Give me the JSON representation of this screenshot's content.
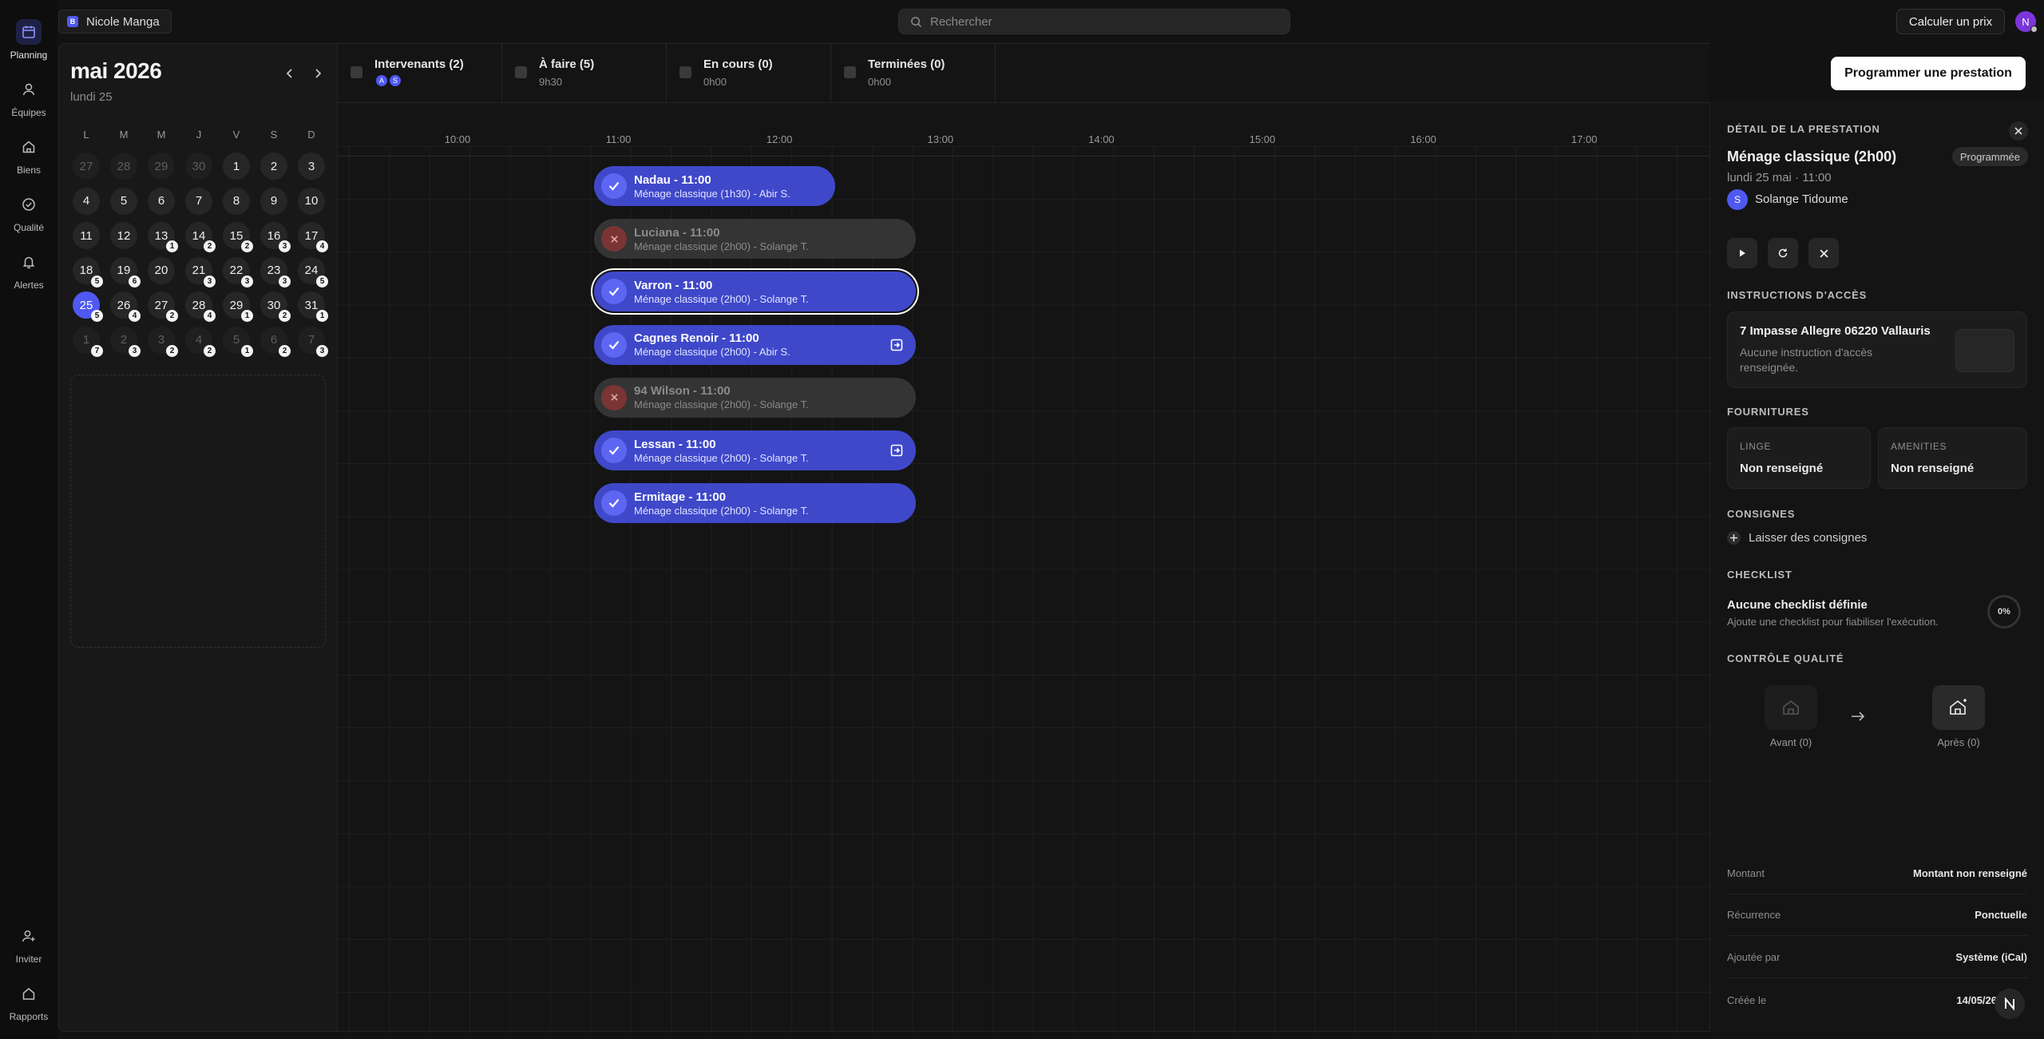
{
  "workspace": {
    "badge": "B",
    "name": "Nicole Manga"
  },
  "search": {
    "placeholder": "Rechercher"
  },
  "header": {
    "calc_button": "Calculer un prix",
    "avatar_initial": "N"
  },
  "nav": {
    "top": [
      {
        "label": "Planning",
        "icon": "calendar-icon",
        "active": true
      },
      {
        "label": "Équipes",
        "icon": "user-icon"
      },
      {
        "label": "Biens",
        "icon": "house-icon"
      },
      {
        "label": "Qualité",
        "icon": "check-circle-icon"
      },
      {
        "label": "Alertes",
        "icon": "bell-icon"
      }
    ],
    "bottom": [
      {
        "label": "Inviter",
        "icon": "user-plus-icon"
      },
      {
        "label": "Rapports",
        "icon": "home-icon"
      }
    ]
  },
  "calendar": {
    "month": "mai 2026",
    "selected_label": "lundi 25",
    "weekdays": [
      "L",
      "M",
      "M",
      "J",
      "V",
      "S",
      "D"
    ],
    "weeks": [
      [
        {
          "d": "27",
          "m": true
        },
        {
          "d": "28",
          "m": true
        },
        {
          "d": "29",
          "m": true
        },
        {
          "d": "30",
          "m": true
        },
        {
          "d": "1"
        },
        {
          "d": "2"
        },
        {
          "d": "3"
        }
      ],
      [
        {
          "d": "4"
        },
        {
          "d": "5"
        },
        {
          "d": "6"
        },
        {
          "d": "7"
        },
        {
          "d": "8"
        },
        {
          "d": "9"
        },
        {
          "d": "10"
        }
      ],
      [
        {
          "d": "11"
        },
        {
          "d": "12"
        },
        {
          "d": "13",
          "c": "1"
        },
        {
          "d": "14",
          "c": "2"
        },
        {
          "d": "15",
          "c": "2"
        },
        {
          "d": "16",
          "c": "3"
        },
        {
          "d": "17",
          "c": "4"
        }
      ],
      [
        {
          "d": "18",
          "c": "5"
        },
        {
          "d": "19",
          "c": "6"
        },
        {
          "d": "20"
        },
        {
          "d": "21",
          "c": "3"
        },
        {
          "d": "22",
          "c": "3"
        },
        {
          "d": "23",
          "c": "3"
        },
        {
          "d": "24",
          "c": "5"
        }
      ],
      [
        {
          "d": "25",
          "c": "5",
          "s": true
        },
        {
          "d": "26",
          "c": "4"
        },
        {
          "d": "27",
          "c": "2"
        },
        {
          "d": "28",
          "c": "4"
        },
        {
          "d": "29",
          "c": "1"
        },
        {
          "d": "30",
          "c": "2"
        },
        {
          "d": "31",
          "c": "1"
        }
      ],
      [
        {
          "d": "1",
          "m": true,
          "c": "7"
        },
        {
          "d": "2",
          "m": true,
          "c": "3"
        },
        {
          "d": "3",
          "m": true,
          "c": "2"
        },
        {
          "d": "4",
          "m": true,
          "c": "2"
        },
        {
          "d": "5",
          "m": true,
          "c": "1"
        },
        {
          "d": "6",
          "m": true,
          "c": "2"
        },
        {
          "d": "7",
          "m": true,
          "c": "3"
        }
      ]
    ]
  },
  "stats": [
    {
      "label": "Intervenants (2)",
      "sub": "",
      "avatars": [
        "A",
        "S"
      ]
    },
    {
      "label": "À faire (5)",
      "sub": "9h30"
    },
    {
      "label": "En cours (0)",
      "sub": "0h00"
    },
    {
      "label": "Terminées (0)",
      "sub": "0h00"
    }
  ],
  "schedule_button": "Programmer une prestation",
  "hours": [
    "10:00",
    "11:00",
    "12:00",
    "13:00",
    "14:00",
    "15:00",
    "16:00",
    "17:00"
  ],
  "events": [
    {
      "title": "Nadau - 11:00",
      "sub": "Ménage classique (1h30) - Abir S.",
      "status": "done"
    },
    {
      "title": "Luciana - 11:00",
      "sub": "Ménage classique (2h00) - Solange T.",
      "status": "cancelled"
    },
    {
      "title": "Varron - 11:00",
      "sub": "Ménage classique (2h00) - Solange T.",
      "status": "done",
      "selected": true
    },
    {
      "title": "Cagnes Renoir - 11:00",
      "sub": "Ménage classique (2h00) - Abir S.",
      "status": "done",
      "exit": true
    },
    {
      "title": "94 Wilson - 11:00",
      "sub": "Ménage classique (2h00) - Solange T.",
      "status": "cancelled"
    },
    {
      "title": "Lessan - 11:00",
      "sub": "Ménage classique (2h00) - Solange T.",
      "status": "done",
      "exit": true
    },
    {
      "title": "Ermitage - 11:00",
      "sub": "Ménage classique (2h00) - Solange T.",
      "status": "done"
    }
  ],
  "detail": {
    "header": "DÉTAIL DE LA PRESTATION",
    "title": "Ménage classique (2h00)",
    "status_badge": "Programmée",
    "datetime": "lundi 25 mai · 11:00",
    "assignee_initial": "S",
    "assignee": "Solange Tidoume",
    "access_header": "INSTRUCTIONS D'ACCÈS",
    "address": "7 Impasse Allegre 06220 Vallauris",
    "access_note": "Aucune instruction d'accès renseignée.",
    "supplies_header": "FOURNITURES",
    "linge_label": "LINGE",
    "linge_value": "Non renseigné",
    "amenities_label": "AMENITIES",
    "amenities_value": "Non renseigné",
    "instructions_header": "CONSIGNES",
    "leave_instructions": "Laisser des consignes",
    "checklist_header": "CHECKLIST",
    "checklist_title": "Aucune checklist définie",
    "checklist_sub": "Ajoute une checklist pour fiabiliser l'exécution.",
    "checklist_progress": "0%",
    "qc_header": "CONTRÔLE QUALITÉ",
    "before": "Avant (0)",
    "after": "Après (0)",
    "rows": [
      {
        "k": "Montant",
        "v": "Montant non renseigné"
      },
      {
        "k": "Récurrence",
        "v": "Ponctuelle"
      },
      {
        "k": "Ajoutée par",
        "v": "Système (iCal)"
      },
      {
        "k": "Créée le",
        "v": "14/05/26"
      }
    ]
  },
  "colors": {
    "accent": "#4f58f0",
    "event_done": "#3f48c9",
    "event_cancelled": "#343434"
  }
}
